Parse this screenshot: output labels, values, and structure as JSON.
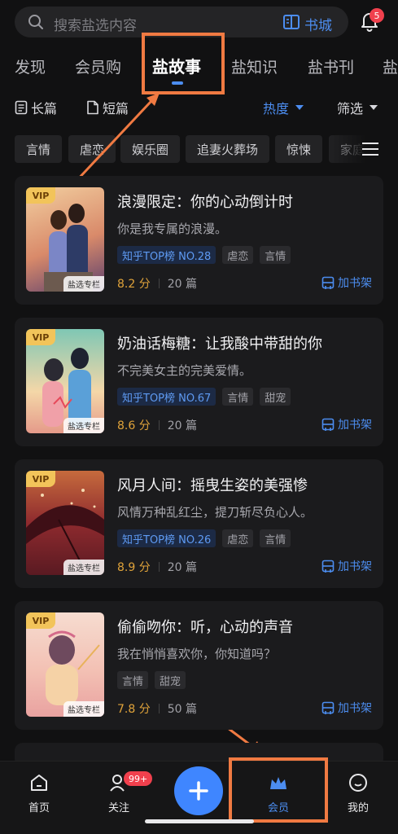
{
  "search": {
    "placeholder": "搜索盐选内容",
    "store_label": "书城",
    "bell_badge": "5"
  },
  "tabs": [
    {
      "label": "发现"
    },
    {
      "label": "会员购"
    },
    {
      "label": "盐故事",
      "active": true
    },
    {
      "label": "盐知识"
    },
    {
      "label": "盐书刊"
    },
    {
      "label": "盐"
    }
  ],
  "filters": {
    "long": "长篇",
    "short": "短篇",
    "sort": "热度",
    "screen": "筛选"
  },
  "chips": [
    "言情",
    "虐恋",
    "娱乐圈",
    "追妻火葬场",
    "惊悚",
    "家庭"
  ],
  "cover_vip": "VIP",
  "cover_label": "盐选专栏",
  "add_shelf_label": "加书架",
  "books": [
    {
      "title": "浪漫限定：你的心动倒计时",
      "subtitle": "你是我专属的浪漫。",
      "tags": [
        "知乎TOP榜 NO.28",
        "虐恋",
        "言情"
      ],
      "score": "8.2 分",
      "chapters": "20 篇"
    },
    {
      "title": "奶油话梅糖：让我酸中带甜的你",
      "subtitle": "不完美女主的完美爱情。",
      "tags": [
        "知乎TOP榜 NO.67",
        "言情",
        "甜宠"
      ],
      "score": "8.6 分",
      "chapters": "20 篇"
    },
    {
      "title": "风月人间：摇曳生姿的美强惨",
      "subtitle": "风情万种乱红尘，提刀斩尽负心人。",
      "tags": [
        "知乎TOP榜 NO.26",
        "虐恋",
        "言情"
      ],
      "score": "8.9 分",
      "chapters": "20 篇"
    },
    {
      "title": "偷偷吻你：听，心动的声音",
      "subtitle": "我在悄悄喜欢你，你知道吗？",
      "tags": [
        "言情",
        "甜宠"
      ],
      "score": "7.8 分",
      "chapters": "50 篇"
    }
  ],
  "bottom_nav": {
    "home": "首页",
    "follow": "关注",
    "follow_badge": "99+",
    "member": "会员",
    "mine": "我的"
  },
  "colors": {
    "accent": "#4c8df0",
    "annotation": "#f07a42",
    "score": "#e0a33a"
  }
}
